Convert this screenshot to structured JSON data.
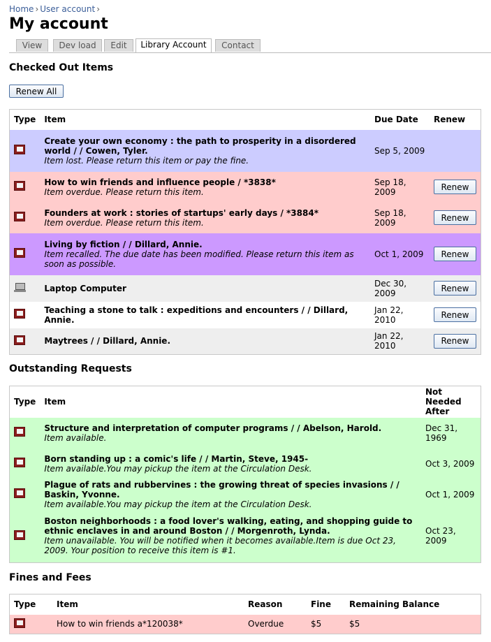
{
  "breadcrumb": [
    {
      "label": "Home"
    },
    {
      "label": "User account"
    }
  ],
  "breadcrumb_sep": "›",
  "page_title": "My account",
  "tabs": [
    {
      "label": "View"
    },
    {
      "label": "Dev load"
    },
    {
      "label": "Edit"
    },
    {
      "label": "Library Account"
    },
    {
      "label": "Contact"
    }
  ],
  "active_tab": "Library Account",
  "checked_out": {
    "title": "Checked Out Items",
    "renew_all_label": "Renew All",
    "headers": {
      "type": "Type",
      "item": "Item",
      "due": "Due Date",
      "renew": "Renew"
    },
    "rows": [
      {
        "icon": "book-icon",
        "title": "Create your own economy : the path to prosperity in a disordered world / / Cowen, Tyler.",
        "message": "Item lost. Please return this item or pay the fine.",
        "due": "Sep 5, 2009",
        "renew_label": "",
        "status": "lost"
      },
      {
        "icon": "book-icon",
        "title": "How to win friends and influence people / *3838*",
        "message": "Item overdue. Please return this item.",
        "due": "Sep 18, 2009",
        "renew_label": "Renew",
        "status": "overdue"
      },
      {
        "icon": "book-icon",
        "title": "Founders at work : stories of startups' early days / *3884*",
        "message": "Item overdue. Please return this item.",
        "due": "Sep 18, 2009",
        "renew_label": "Renew",
        "status": "overdue"
      },
      {
        "icon": "book-icon",
        "title": "Living by fiction / / Dillard, Annie.",
        "message": "Item recalled. The due date has been modified. Please return this item as soon as possible.",
        "due": "Oct 1, 2009",
        "renew_label": "Renew",
        "status": "recalled"
      },
      {
        "icon": "laptop-icon",
        "title": "Laptop Computer",
        "message": "",
        "due": "Dec 30, 2009",
        "renew_label": "Renew",
        "status": "normal-gray"
      },
      {
        "icon": "book-icon",
        "title": "Teaching a stone to talk : expeditions and encounters / / Dillard, Annie.",
        "message": "",
        "due": "Jan 22, 2010",
        "renew_label": "Renew",
        "status": "normal-white"
      },
      {
        "icon": "book-icon",
        "title": "Maytrees / / Dillard, Annie.",
        "message": "",
        "due": "Jan 22, 2010",
        "renew_label": "Renew",
        "status": "normal-gray"
      }
    ]
  },
  "requests": {
    "title": "Outstanding Requests",
    "headers": {
      "type": "Type",
      "item": "Item",
      "not_needed_line1": "Not Needed",
      "not_needed_line2": "After"
    },
    "rows": [
      {
        "icon": "book-icon",
        "title": "Structure and interpretation of computer programs / / Abelson, Harold.",
        "message": "Item available.",
        "date": "Dec 31, 1969"
      },
      {
        "icon": "book-icon",
        "title": "Born standing up : a comic's life / / Martin, Steve, 1945-",
        "message": "Item available.You may pickup the item at the Circulation Desk.",
        "date": "Oct 3, 2009"
      },
      {
        "icon": "book-icon",
        "title": "Plague of rats and rubbervines : the growing threat of species invasions / / Baskin, Yvonne.",
        "message": "Item available.You may pickup the item at the Circulation Desk.",
        "date": "Oct 1, 2009"
      },
      {
        "icon": "book-icon",
        "title": "Boston neighborhoods : a food lover's walking, eating, and shopping guide to ethnic enclaves in and around Boston / / Morgenroth, Lynda.",
        "message": "Item unavailable. You will be notified when it becomes available.Item is due Oct 23, 2009. Your position to receive this item is #1.",
        "date": "Oct 23, 2009"
      }
    ]
  },
  "fines": {
    "title": "Fines and Fees",
    "headers": {
      "type": "Type",
      "item": "Item",
      "reason": "Reason",
      "fine": "Fine",
      "balance": "Remaining Balance"
    },
    "rows": [
      {
        "icon": "book-icon",
        "item": "How to win friends a*120038*",
        "reason": "Overdue",
        "fine": "$5",
        "balance": "$5"
      }
    ]
  },
  "colors": {
    "lost": "#ccccff",
    "overdue": "#ffcccc",
    "recalled": "#cc99ff",
    "normal_gray": "#eeeeee",
    "available": "#ccffcc",
    "link": "#3b5e99"
  }
}
